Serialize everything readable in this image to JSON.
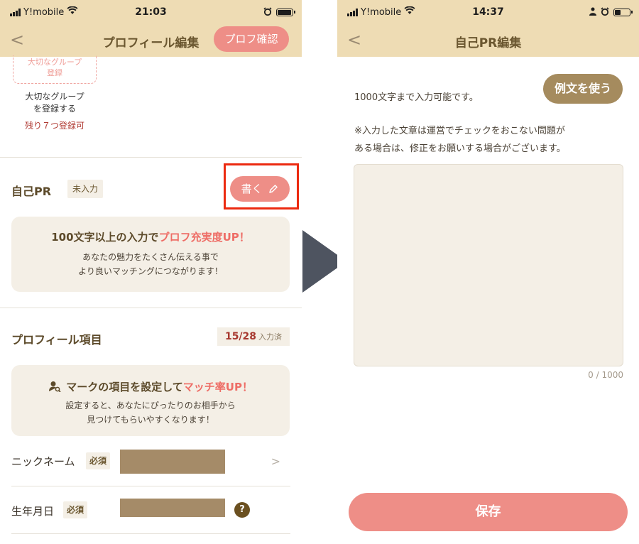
{
  "left": {
    "status": {
      "carrier": "Y!mobile",
      "time": "21:03"
    },
    "nav": {
      "back": "<",
      "title": "プロフィール編集",
      "action": "プロフ確認"
    },
    "group": {
      "box": "大切なグループ\n登録",
      "text": "大切なグループ\nを登録する",
      "remain": "残り７つ登録可"
    },
    "pr": {
      "title": "自己PR",
      "tag": "未入力",
      "write": "書く"
    },
    "pr_card": {
      "head_pre": "100文字以上の入力で",
      "head_hl": "プロフ充実度UP！",
      "body": "あなたの魅力をたくさん伝える事で\nより良いマッチングにつながります！"
    },
    "items": {
      "title": "プロフィール項目",
      "count": "15/28",
      "count_sub": "入力済"
    },
    "match_card": {
      "head_pre": "マークの項目を設定して",
      "head_hl": "マッチ率UP！",
      "body": "設定すると、あなたにぴったりのお相手から\n見つけてもらいやすくなります！"
    },
    "fields": [
      {
        "label": "ニックネーム",
        "req": "必須",
        "chevron": ">"
      },
      {
        "label": "生年月日",
        "req": "必須",
        "help": "?"
      }
    ]
  },
  "right": {
    "status": {
      "carrier": "Y!mobile",
      "time": "14:37"
    },
    "nav": {
      "back": "<",
      "title": "自己PR編集"
    },
    "limit": "1000文字まで入力可能です。",
    "example": "例文を使う",
    "note": "※入力した文章は運営でチェックをおこない問題が\nある場合は、修正をお願いする場合がございます。",
    "counter": "0 / 1000",
    "save": "保存"
  },
  "colors": {
    "header": "#eedcb4",
    "accent": "#ee8e87",
    "card": "#f4efe6",
    "highlight": "#ec2a10",
    "brown": "#a58b5e"
  }
}
